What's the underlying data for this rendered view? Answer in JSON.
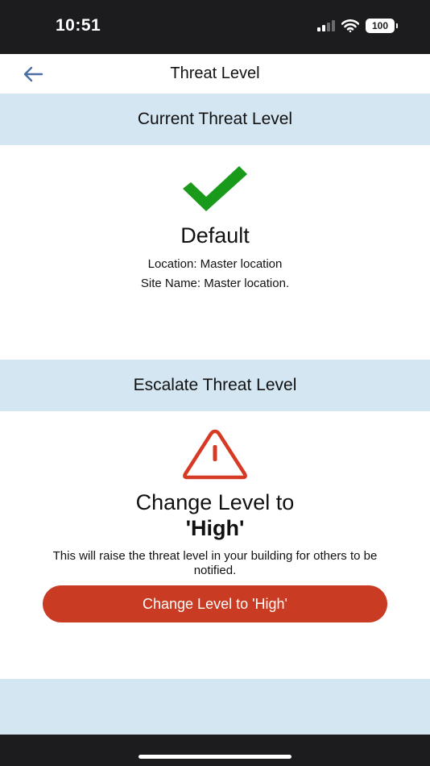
{
  "status_bar": {
    "time": "10:51",
    "battery": "100",
    "icons": [
      "signal-icon",
      "wifi-icon",
      "battery-icon"
    ]
  },
  "header": {
    "back_icon": "arrow-left-icon",
    "title": "Threat Level"
  },
  "current": {
    "section_title": "Current Threat Level",
    "status_icon": "checkmark-icon",
    "level": "Default",
    "location_line": "Location: Master location",
    "site_line": "Site Name:  Master location."
  },
  "escalate": {
    "section_title": "Escalate Threat Level",
    "warning_icon": "warning-triangle-icon",
    "title_line1": "Change Level to",
    "title_line2": "'High'",
    "description": "This will raise the threat level in your building for others to be notified.",
    "button_label": "Change Level to 'High'"
  },
  "colors": {
    "band": "#d4e6f1",
    "check": "#1a9a1a",
    "warning": "#d63a25",
    "button": "#c93b22",
    "back_arrow": "#4a6fa0",
    "system_bar": "#1c1c1e"
  }
}
